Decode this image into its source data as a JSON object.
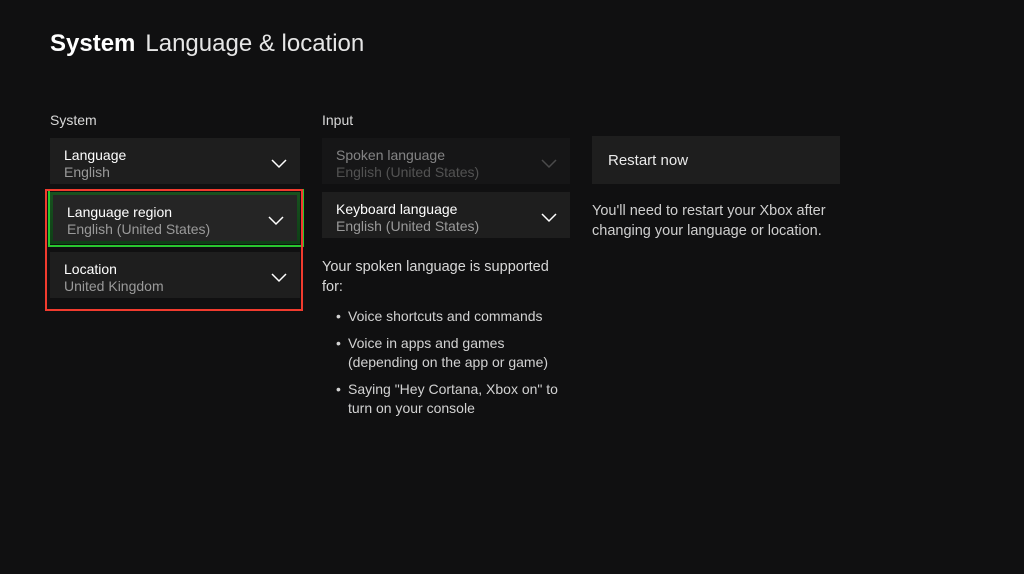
{
  "header": {
    "bold": "System",
    "light": "Language & location"
  },
  "system": {
    "section_label": "System",
    "language": {
      "label": "Language",
      "value": "English"
    },
    "language_region": {
      "label": "Language region",
      "value": "English (United States)"
    },
    "location": {
      "label": "Location",
      "value": "United Kingdom"
    }
  },
  "input": {
    "section_label": "Input",
    "spoken_language": {
      "label": "Spoken language",
      "value": "English (United States)"
    },
    "keyboard_language": {
      "label": "Keyboard language",
      "value": "English (United States)"
    },
    "support_intro": "Your spoken language is supported for:",
    "bullets": {
      "b0": "Voice shortcuts and commands",
      "b1": "Voice in apps and games (depending on the app or game)",
      "b2": "Saying \"Hey Cortana, Xbox on\" to turn on your console"
    }
  },
  "restart": {
    "button": "Restart now",
    "info": "You'll need to restart your Xbox after changing your language or location."
  }
}
